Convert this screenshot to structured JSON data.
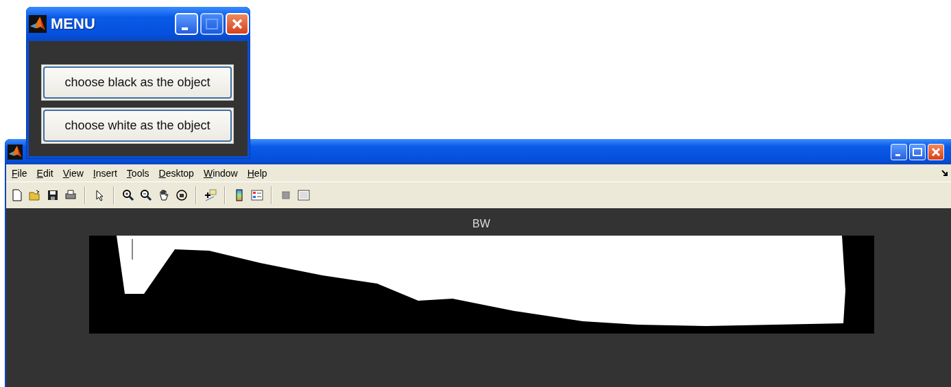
{
  "menu_window": {
    "title": "MENU",
    "buttons": [
      "choose black as the object",
      "choose white as the object"
    ]
  },
  "figure_window": {
    "menu_bar": [
      "File",
      "Edit",
      "View",
      "Insert",
      "Tools",
      "Desktop",
      "Window",
      "Help"
    ],
    "axes_title": "BW"
  }
}
